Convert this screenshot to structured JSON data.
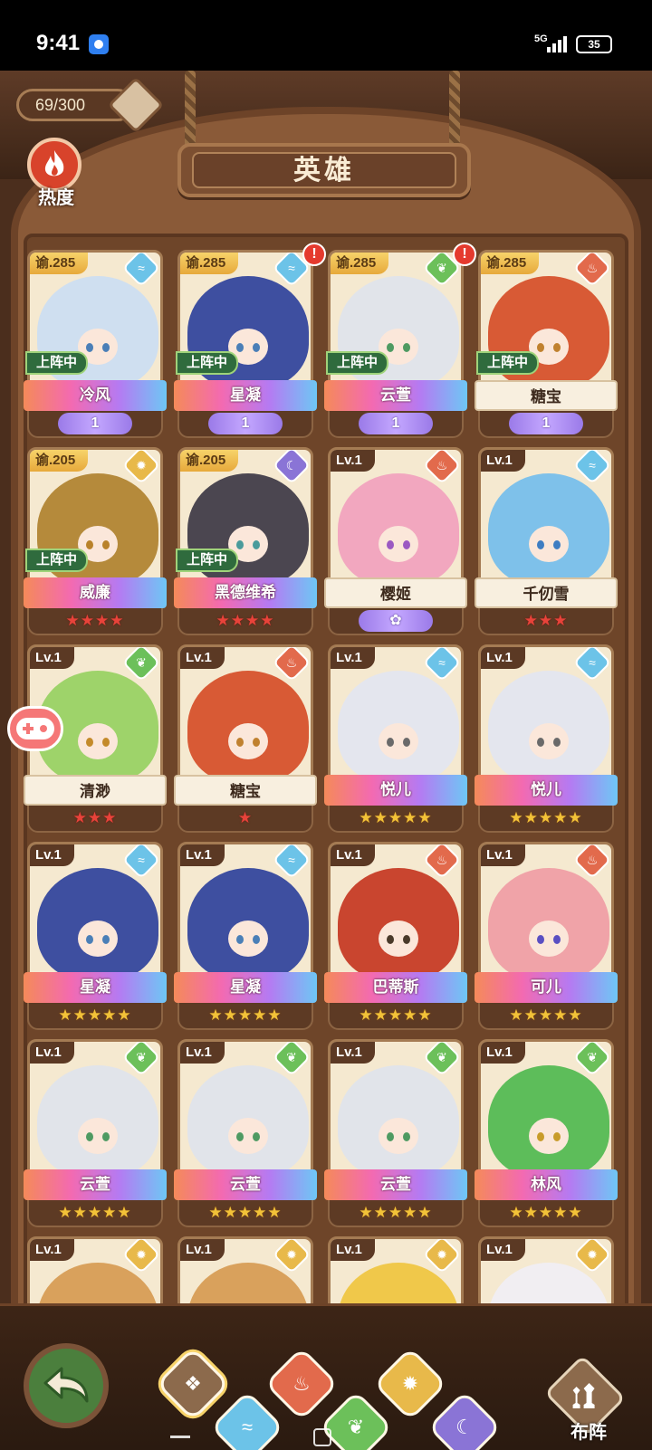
{
  "status_bar": {
    "time": "9:41",
    "network": "5G",
    "battery": "35"
  },
  "header": {
    "counter": "69/300",
    "title": "英雄",
    "heat_label": "热度"
  },
  "cards": [
    {
      "level": "谕.285",
      "gold": true,
      "element": "water",
      "alert": false,
      "deployed": true,
      "deploy_label": "上阵中",
      "name": "冷风",
      "banner": "rainbow",
      "rank": "wing",
      "rank_value": "1",
      "art": "#cfdff0",
      "eye": "#4a7fb7"
    },
    {
      "level": "谕.285",
      "gold": true,
      "element": "water",
      "alert": true,
      "alert_text": "!",
      "deployed": true,
      "deploy_label": "上阵中",
      "name": "星凝",
      "banner": "rainbow",
      "rank": "wing",
      "rank_value": "1",
      "art": "#3e4fa0",
      "eye": "#4a7fb7"
    },
    {
      "level": "谕.285",
      "gold": true,
      "element": "grass",
      "alert": true,
      "alert_text": "!",
      "deployed": true,
      "deploy_label": "上阵中",
      "name": "云萱",
      "banner": "rainbow",
      "rank": "wing",
      "rank_value": "1",
      "art": "#e1e4ea",
      "eye": "#4e9a62"
    },
    {
      "level": "谕.285",
      "gold": true,
      "element": "fire",
      "alert": false,
      "deployed": true,
      "deploy_label": "上阵中",
      "name": "糖宝",
      "banner": "plain",
      "rank": "wing",
      "rank_value": "1",
      "art": "#d85a35",
      "eye": "#c0812f"
    },
    {
      "level": "谕.205",
      "gold": true,
      "element": "light",
      "alert": false,
      "deployed": true,
      "deploy_label": "上阵中",
      "name": "威廉",
      "banner": "rainbow",
      "rank": "stars",
      "stars": "★★★★",
      "star_color": "red",
      "art": "#b58a3b",
      "eye": "#b9822a"
    },
    {
      "level": "谕.205",
      "gold": true,
      "element": "dark",
      "alert": false,
      "deployed": true,
      "deploy_label": "上阵中",
      "name": "黑德维希",
      "banner": "rainbow",
      "rank": "stars",
      "stars": "★★★★",
      "star_color": "red",
      "art": "#4b4650",
      "eye": "#4a9b9b"
    },
    {
      "level": "Lv.1",
      "gold": false,
      "element": "fire",
      "alert": false,
      "deployed": false,
      "name": "樱姬",
      "banner": "plain",
      "rank": "wing",
      "rank_value": "✿",
      "art": "#f2a7bf",
      "eye": "#9b59c2"
    },
    {
      "level": "Lv.1",
      "gold": false,
      "element": "water",
      "alert": false,
      "deployed": false,
      "name": "千仞雪",
      "banner": "plain",
      "rank": "stars",
      "stars": "★★★",
      "star_color": "red",
      "art": "#7ec1ea",
      "eye": "#3e7dc2"
    },
    {
      "level": "Lv.1",
      "gold": false,
      "element": "grass",
      "alert": false,
      "deployed": false,
      "name": "清渺",
      "banner": "plain",
      "rank": "stars",
      "stars": "★★★",
      "star_color": "red",
      "art": "#9ed36a",
      "eye": "#c48a2a"
    },
    {
      "level": "Lv.1",
      "gold": false,
      "element": "fire",
      "alert": false,
      "deployed": false,
      "name": "糖宝",
      "banner": "plain",
      "rank": "stars",
      "stars": "★",
      "star_color": "red",
      "art": "#d85a35",
      "eye": "#c0812f"
    },
    {
      "level": "Lv.1",
      "gold": false,
      "element": "water",
      "alert": false,
      "deployed": false,
      "name": "悦儿",
      "banner": "rainbow",
      "rank": "stars",
      "stars": "★★★★★",
      "star_color": "gold",
      "art": "#e4e6ee",
      "eye": "#6a6a6a"
    },
    {
      "level": "Lv.1",
      "gold": false,
      "element": "water",
      "alert": false,
      "deployed": false,
      "name": "悦儿",
      "banner": "rainbow",
      "rank": "stars",
      "stars": "★★★★★",
      "star_color": "gold",
      "art": "#e4e6ee",
      "eye": "#6a6a6a"
    },
    {
      "level": "Lv.1",
      "gold": false,
      "element": "water",
      "alert": false,
      "deployed": false,
      "name": "星凝",
      "banner": "rainbow",
      "rank": "stars",
      "stars": "★★★★★",
      "star_color": "gold",
      "art": "#3e4fa0",
      "eye": "#4a7fb7"
    },
    {
      "level": "Lv.1",
      "gold": false,
      "element": "water",
      "alert": false,
      "deployed": false,
      "name": "星凝",
      "banner": "rainbow",
      "rank": "stars",
      "stars": "★★★★★",
      "star_color": "gold",
      "art": "#3e4fa0",
      "eye": "#4a7fb7"
    },
    {
      "level": "Lv.1",
      "gold": false,
      "element": "fire",
      "alert": false,
      "deployed": false,
      "name": "巴蒂斯",
      "banner": "rainbow",
      "rank": "stars",
      "stars": "★★★★★",
      "star_color": "gold",
      "art": "#c9452f",
      "eye": "#4a3a2a"
    },
    {
      "level": "Lv.1",
      "gold": false,
      "element": "fire",
      "alert": false,
      "deployed": false,
      "name": "可儿",
      "banner": "rainbow",
      "rank": "stars",
      "stars": "★★★★★",
      "star_color": "gold",
      "art": "#f0a3a8",
      "eye": "#5a4fc2"
    },
    {
      "level": "Lv.1",
      "gold": false,
      "element": "grass",
      "alert": false,
      "deployed": false,
      "name": "云萱",
      "banner": "rainbow",
      "rank": "stars",
      "stars": "★★★★★",
      "star_color": "gold",
      "art": "#e1e4ea",
      "eye": "#4e9a62"
    },
    {
      "level": "Lv.1",
      "gold": false,
      "element": "grass",
      "alert": false,
      "deployed": false,
      "name": "云萱",
      "banner": "rainbow",
      "rank": "stars",
      "stars": "★★★★★",
      "star_color": "gold",
      "art": "#e1e4ea",
      "eye": "#4e9a62"
    },
    {
      "level": "Lv.1",
      "gold": false,
      "element": "grass",
      "alert": false,
      "deployed": false,
      "name": "云萱",
      "banner": "rainbow",
      "rank": "stars",
      "stars": "★★★★★",
      "star_color": "gold",
      "art": "#e1e4ea",
      "eye": "#4e9a62"
    },
    {
      "level": "Lv.1",
      "gold": false,
      "element": "grass",
      "alert": false,
      "deployed": false,
      "name": "林风",
      "banner": "rainbow",
      "rank": "stars",
      "stars": "★★★★★",
      "star_color": "gold",
      "art": "#5dbd5a",
      "eye": "#c89b2a"
    },
    {
      "level": "Lv.1",
      "gold": false,
      "element": "light",
      "alert": false,
      "deployed": false,
      "name": "",
      "banner": "none",
      "rank": "none",
      "art": "#d9a15c",
      "eye": "#6a4a2a"
    },
    {
      "level": "Lv.1",
      "gold": false,
      "element": "light",
      "alert": false,
      "deployed": false,
      "name": "",
      "banner": "none",
      "rank": "none",
      "art": "#d9a15c",
      "eye": "#6a4a2a"
    },
    {
      "level": "Lv.1",
      "gold": false,
      "element": "light",
      "alert": false,
      "deployed": false,
      "name": "",
      "banner": "none",
      "rank": "none",
      "art": "#f0c84a",
      "eye": "#6a4a2a"
    },
    {
      "level": "Lv.1",
      "gold": false,
      "element": "light",
      "alert": false,
      "deployed": false,
      "name": "",
      "banner": "none",
      "rank": "none",
      "art": "#f1eef2",
      "eye": "#6a4a2a"
    }
  ],
  "elements": {
    "water": {
      "color": "#6cc3e8",
      "icon": "water-swirl-icon",
      "glyph": "≈"
    },
    "grass": {
      "color": "#6cc05a",
      "icon": "leaf-icon",
      "glyph": "❦"
    },
    "fire": {
      "color": "#e26a4c",
      "icon": "flame-icon",
      "glyph": "♨"
    },
    "light": {
      "color": "#e8b94a",
      "icon": "sun-icon",
      "glyph": "✹"
    },
    "dark": {
      "color": "#8a74d6",
      "icon": "moon-icon",
      "glyph": "☾"
    }
  },
  "bottom_bar": {
    "filters": [
      {
        "icon": "all-diamonds-icon",
        "color": "#8c6a4c",
        "glyph": "❖",
        "selected": true
      },
      {
        "icon": "water-swirl-icon",
        "color": "#6cc3e8",
        "glyph": "≈",
        "selected": false
      },
      {
        "icon": "flame-icon",
        "color": "#e26a4c",
        "glyph": "♨",
        "selected": false
      },
      {
        "icon": "leaf-icon",
        "color": "#6cc05a",
        "glyph": "❦",
        "selected": false
      },
      {
        "icon": "sun-icon",
        "color": "#e8b94a",
        "glyph": "✹",
        "selected": false
      },
      {
        "icon": "moon-icon",
        "color": "#8a74d6",
        "glyph": "☾",
        "selected": false
      }
    ],
    "lineup_label": "布阵"
  }
}
